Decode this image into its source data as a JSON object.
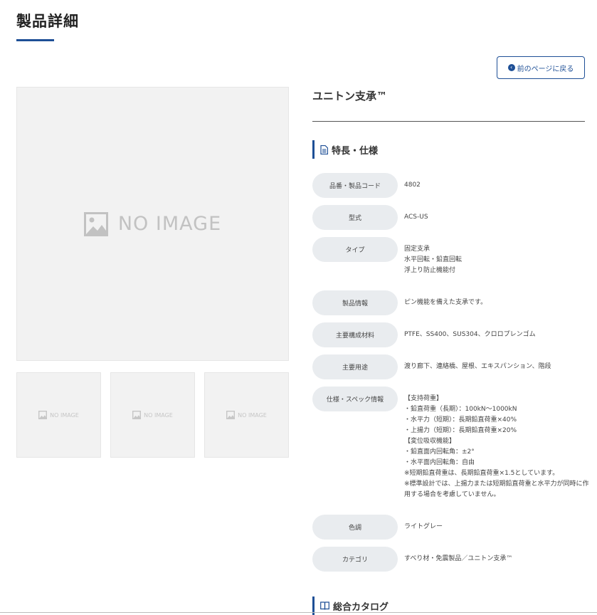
{
  "page": {
    "title": "製品詳細"
  },
  "back_button": {
    "label": "前のページに戻る"
  },
  "gallery": {
    "main_placeholder": "NO IMAGE",
    "thumb_placeholders": [
      "NO IMAGE",
      "NO IMAGE",
      "NO IMAGE"
    ]
  },
  "product": {
    "name": "ユニトン支承™"
  },
  "spec_section": {
    "title": "特長・仕様"
  },
  "specs": [
    {
      "label": "品番・製品コード",
      "value": "4802"
    },
    {
      "label": "型式",
      "value": "ACS-US"
    },
    {
      "label": "タイプ",
      "value": "固定支承\n水平回転・鉛直回転\n浮上り防止機能付"
    },
    {
      "label": "製品情報",
      "value": "ピン機能を備えた支承です。"
    },
    {
      "label": "主要構成材料",
      "value": "PTFE、SS400、SUS304、クロロプレンゴム"
    },
    {
      "label": "主要用途",
      "value": "渡り廊下、連絡橋、屋根、エキスパンション、階段"
    },
    {
      "label": "仕様・スペック情報",
      "value": "【支持荷重】\n・鉛直荷重（長期）：100kN〜1000kN\n・水平力（短期）：長期鉛直荷重×40%\n・上揚力（短期）：長期鉛直荷重×20%\n【変位吸収機能】\n・鉛直面内回転角：±2°\n・水平面内回転角：自由\n※短期鉛直荷重は、長期鉛直荷重×1.5としています。\n※標準設計では、上揚力または短期鉛直荷重と水平力が同時に作用する場合を考慮していません。"
    },
    {
      "label": "色調",
      "value": "ライトグレー"
    },
    {
      "label": "カテゴリ",
      "value": "すべり材・免震製品／ユニトン支承™"
    }
  ],
  "catalog_section": {
    "title": "総合カタログ"
  },
  "colors": {
    "accent": "#1e4f96",
    "label_bg": "#e9ecef",
    "placeholder_bg": "#f2f2f2"
  }
}
